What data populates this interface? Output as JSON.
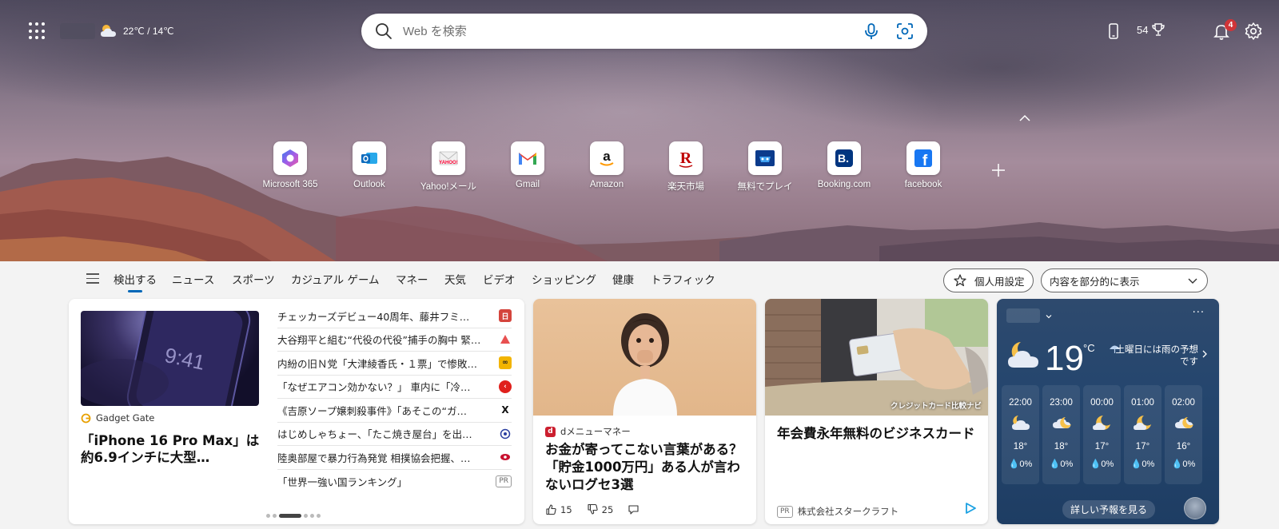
{
  "topbar": {
    "weather_temp": "22℃ / 14℃",
    "search_placeholder": "Web を検索",
    "points": "54",
    "notif_count": "4"
  },
  "quick_links": [
    {
      "label": "Microsoft 365",
      "icon": "microsoft365-icon"
    },
    {
      "label": "Outlook",
      "icon": "outlook-icon"
    },
    {
      "label": "Yahoo!メール",
      "icon": "yahoo-mail-icon"
    },
    {
      "label": "Gmail",
      "icon": "gmail-icon"
    },
    {
      "label": "Amazon",
      "icon": "amazon-icon"
    },
    {
      "label": "楽天市場",
      "icon": "rakuten-icon"
    },
    {
      "label": "無料でプレイ",
      "icon": "game-icon"
    },
    {
      "label": "Booking.com",
      "icon": "booking-icon"
    },
    {
      "label": "facebook",
      "icon": "facebook-icon"
    }
  ],
  "nav": {
    "items": [
      "検出する",
      "ニュース",
      "スポーツ",
      "カジュアル ゲーム",
      "マネー",
      "天気",
      "ビデオ",
      "ショッピング",
      "健康",
      "トラフィック"
    ],
    "personalize": "個人用設定",
    "content_toggle": "内容を部分的に表示"
  },
  "card1": {
    "source": "Gadget Gate",
    "headline": "「iPhone 16 Pro Max」は約6.9インチに大型…",
    "news": [
      {
        "title": "チェッカーズデビュー40周年、藤井フミ…",
        "color": "#d4443c"
      },
      {
        "title": "大谷翔平と組む“代役の代役”捕手の胸中 緊…",
        "color": "#e85050"
      },
      {
        "title": "内紛の旧Ｎ党「大津綾香氏・１票」で惨敗…",
        "color": "#e8a000"
      },
      {
        "title": "「なぜエアコン効かない？」 車内に「冷…",
        "color": "#e0201c"
      },
      {
        "title": "《吉原ソープ嬢刺殺事件》「あそこの“ガ…",
        "color": "#111111"
      },
      {
        "title": "はじめしゃちょー、「たこ焼き屋台」を出…",
        "color": "#2a3ea0"
      },
      {
        "title": "陸奥部屋で暴力行為発覚 相撲協会把握、…",
        "color": "#c8102e"
      },
      {
        "title": "「世界一強い国ランキング」",
        "color": "PR"
      }
    ]
  },
  "card2": {
    "source": "dメニューマネー",
    "headline": "お金が寄ってこない言葉がある？「貯金1000万円」ある人が言わないログセ3選",
    "likes": "15",
    "dislikes": "25"
  },
  "card3": {
    "image_tag": "クレジットカード比較ナビ",
    "headline": "年会費永年無料のビジネスカード",
    "pr": "PR",
    "sponsor": "株式会社スタークラフト"
  },
  "weather": {
    "temp": "19",
    "unit": "°C",
    "desc": "土曜日には雨の予想です",
    "hours": [
      {
        "time": "22:00",
        "temp": "18°",
        "precip": "0%",
        "icon": "partly-cloudy-night-icon"
      },
      {
        "time": "23:00",
        "temp": "18°",
        "precip": "0%",
        "icon": "partly-cloudy-moon-icon"
      },
      {
        "time": "00:00",
        "temp": "17°",
        "precip": "0%",
        "icon": "moon-cloud-icon"
      },
      {
        "time": "01:00",
        "temp": "17°",
        "precip": "0%",
        "icon": "moon-cloud-icon"
      },
      {
        "time": "02:00",
        "temp": "16°",
        "precip": "0%",
        "icon": "partly-cloudy-moon-icon"
      }
    ],
    "more": "詳しい予報を見る"
  }
}
